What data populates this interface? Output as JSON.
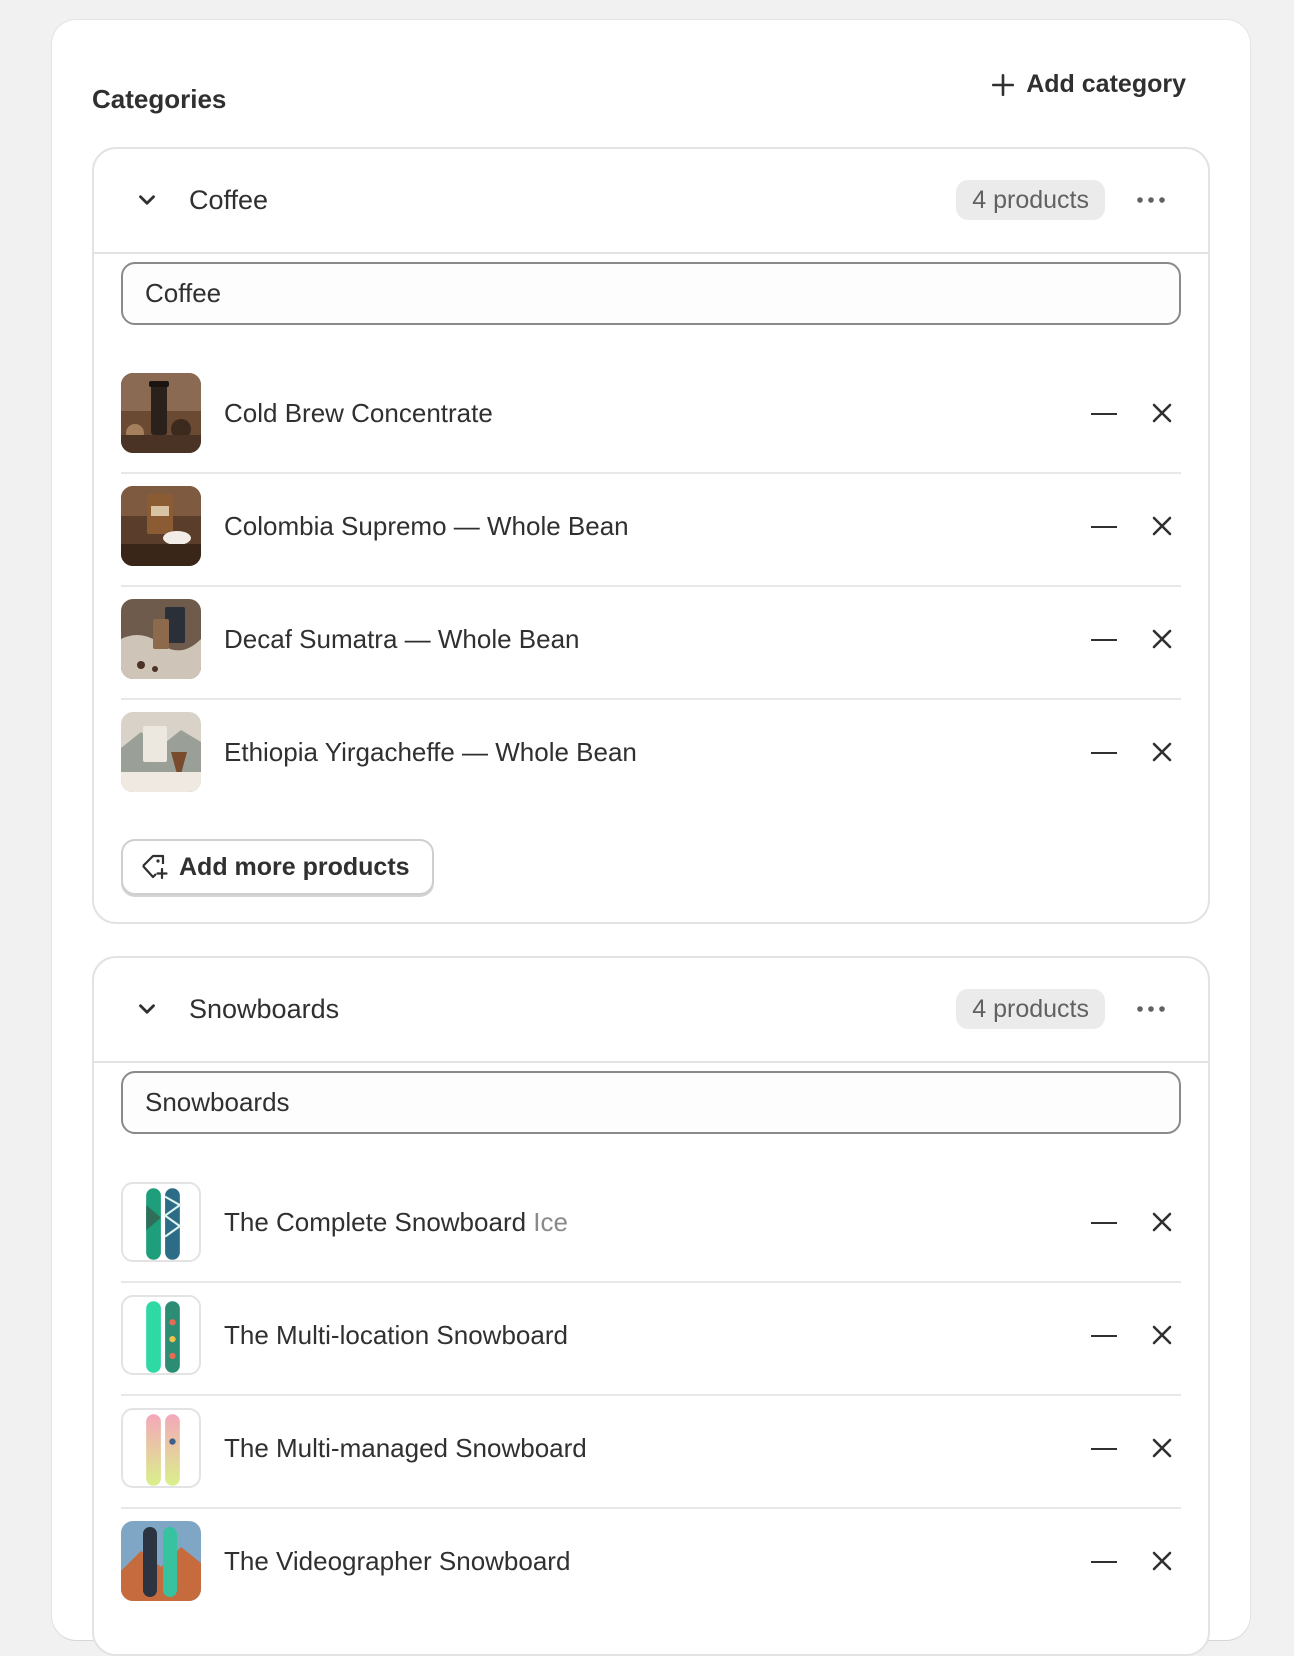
{
  "page": {
    "title": "Categories",
    "add_category_label": "Add category"
  },
  "colors": {
    "text": "#303030",
    "muted": "#616161",
    "border": "#e3e3e3",
    "badge_bg": "#ebebeb"
  },
  "categories": [
    {
      "name": "Coffee",
      "count_label": "4 products",
      "input_value": "Coffee",
      "products": [
        {
          "name": "Cold Brew Concentrate",
          "variant": ""
        },
        {
          "name": "Colombia Supremo — Whole Bean",
          "variant": ""
        },
        {
          "name": "Decaf Sumatra — Whole Bean",
          "variant": ""
        },
        {
          "name": "Ethiopia Yirgacheffe — Whole Bean",
          "variant": ""
        }
      ],
      "add_more_label": "Add more products"
    },
    {
      "name": "Snowboards",
      "count_label": "4 products",
      "input_value": "Snowboards",
      "products": [
        {
          "name": "The Complete Snowboard",
          "variant": "Ice"
        },
        {
          "name": "The Multi-location Snowboard",
          "variant": ""
        },
        {
          "name": "The Multi-managed Snowboard",
          "variant": ""
        },
        {
          "name": "The Videographer Snowboard",
          "variant": ""
        }
      ]
    }
  ],
  "icons": {
    "add": "plus-icon",
    "collapse": "chevron-down-icon",
    "more": "ellipsis-icon",
    "drag": "drag-handle-icon",
    "remove": "close-icon",
    "add_products": "tag-plus-icon"
  }
}
